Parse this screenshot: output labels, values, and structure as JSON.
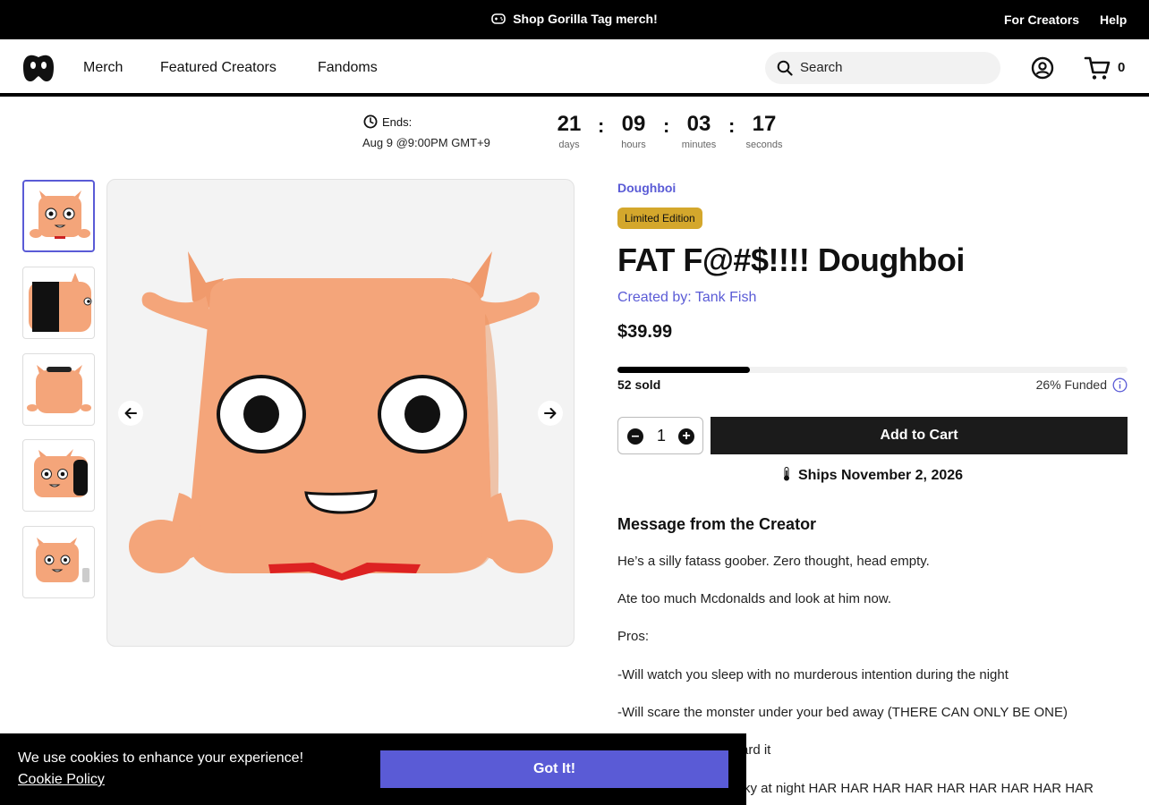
{
  "topbar": {
    "promo": "Shop Gorilla Tag merch!",
    "links": [
      "For Creators",
      "Help"
    ]
  },
  "nav": {
    "logo": "logo-icon",
    "links": [
      "Merch",
      "Featured Creators",
      "Fandoms"
    ],
    "search_placeholder": "Search",
    "cart_count": "0"
  },
  "countdown": {
    "ends_label": "Ends:",
    "ends_date": "Aug 9 @9:00PM GMT+9",
    "units": [
      {
        "value": "21",
        "label": "days"
      },
      {
        "value": "09",
        "label": "hours"
      },
      {
        "value": "03",
        "label": "minutes"
      },
      {
        "value": "17",
        "label": "seconds"
      }
    ],
    "separator": ":"
  },
  "gallery": {
    "thumbnails": [
      "Front view",
      "Side view",
      "Back view",
      "Angled view",
      "Size comparison"
    ],
    "selected_index": 0
  },
  "product": {
    "brand": "Doughboi",
    "badge": "Limited Edition",
    "title": "FAT F@#$!!!! Doughboi",
    "creator": "Created by: Tank Fish",
    "price": "$39.99",
    "funded_fraction": 0.26,
    "sold": "52 sold",
    "funded": "26% Funded",
    "quantity": "1",
    "add_to_cart": "Add to Cart",
    "ships": "Ships November 2, 2026"
  },
  "message": {
    "title": "Message from the Creator",
    "paragraphs": [
      "He’s a silly fatass goober. Zero thought, head empty.",
      "Ate too much Mcdonalds and look at him now.",
      "Pros:",
      "-Will watch you sleep with no murderous intention during the night",
      "-Will scare the monster under your bed away (THERE CAN ONLY BE ONE)",
      "ard it",
      "rky at night HAR HAR HAR HAR HAR HAR HAR HAR HAR"
    ]
  },
  "cookie": {
    "text": "We use cookies to enhance your experience!",
    "link": "Cookie Policy",
    "button": "Got It!"
  },
  "colors": {
    "accent": "#5a5bd6",
    "badge": "#d4a72c",
    "plush": "#f4a57a"
  }
}
